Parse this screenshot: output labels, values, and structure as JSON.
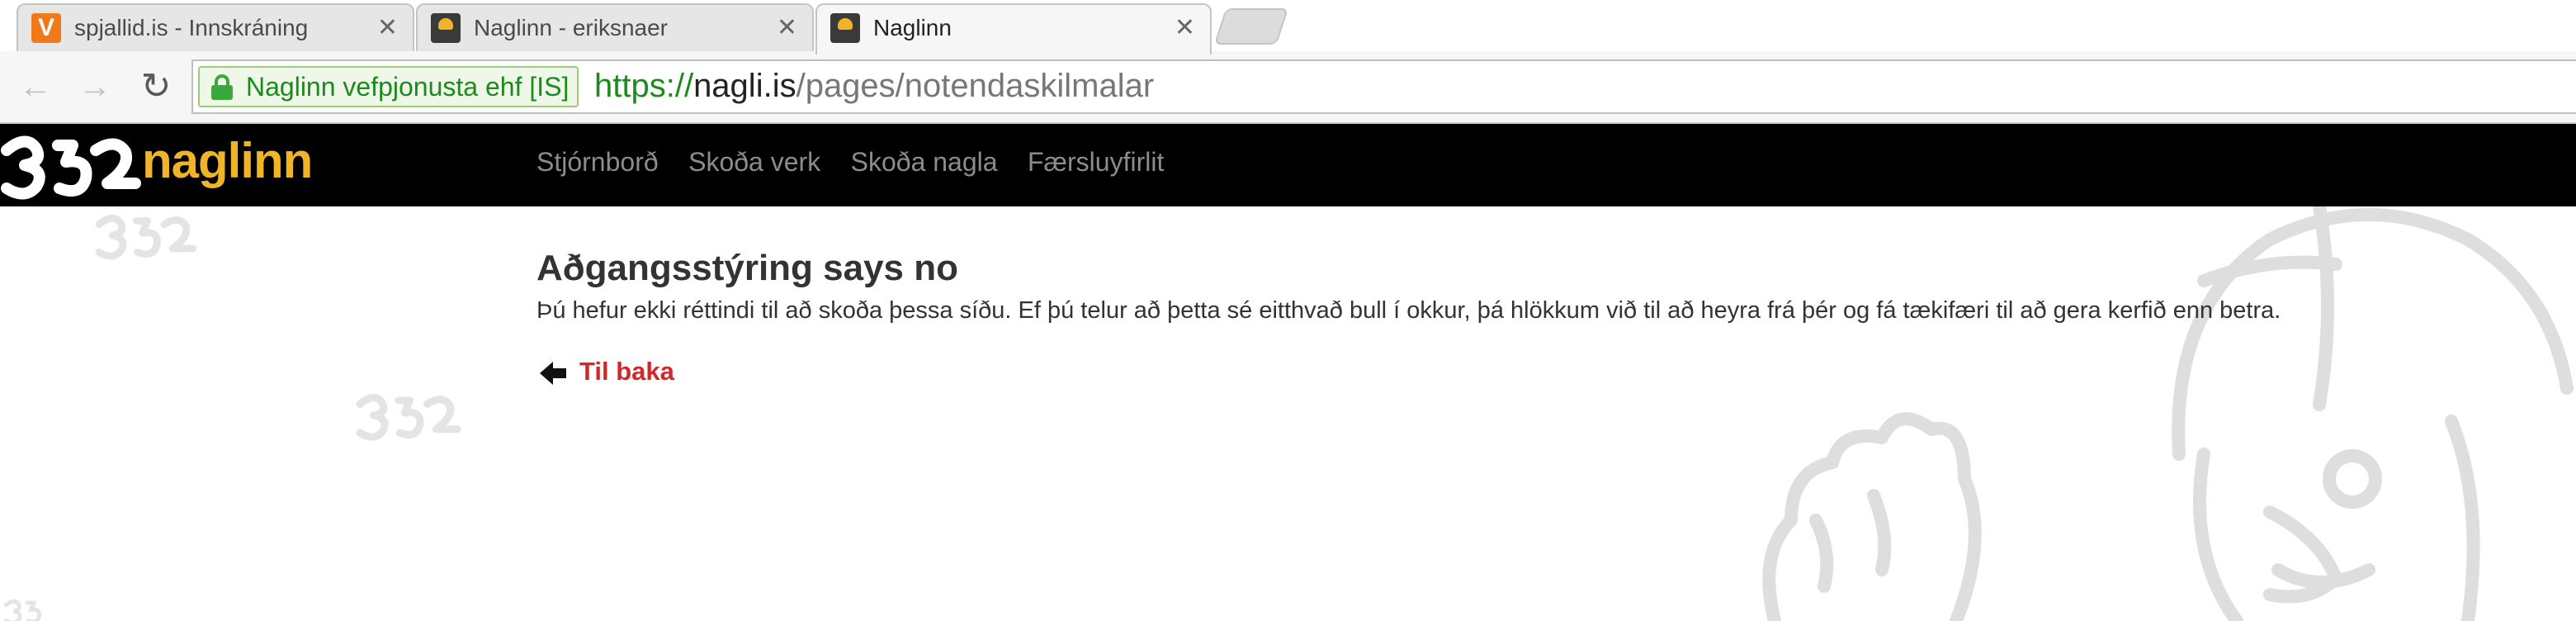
{
  "browser": {
    "tabs": [
      {
        "title": "spjallid.is - Innskráning",
        "favicon": "vivaldi-v-icon",
        "active": false
      },
      {
        "title": "Naglinn - eriksnaer",
        "favicon": "naglinn-helmet-icon",
        "active": false
      },
      {
        "title": "Naglinn",
        "favicon": "naglinn-helmet-icon",
        "active": true
      }
    ],
    "security_badge": "Naglinn vefpjonusta ehf [IS]",
    "url": {
      "scheme": "https://",
      "host": "nagli.is",
      "path": "/pages/notendaskilmalar"
    }
  },
  "site": {
    "logo_text": "naglinn",
    "nav": [
      "Stjórnborð",
      "Skoða verk",
      "Skoða nagla",
      "Færsluyfirlit"
    ]
  },
  "main": {
    "heading": "Aðgangsstýring says no",
    "message": "Þú hefur ekki réttindi til að skoða þessa síðu. Ef þú telur að þetta sé eitthvað bull í okkur, þá hlökkum við til að heyra frá þér og fá tækifæri til að gera kerfið enn betra.",
    "back_link": "Til baka"
  },
  "colors": {
    "header_bg": "#000000",
    "logo_accent": "#f0b429",
    "link_red": "#d0282a",
    "ssl_green": "#1d8a1d"
  }
}
